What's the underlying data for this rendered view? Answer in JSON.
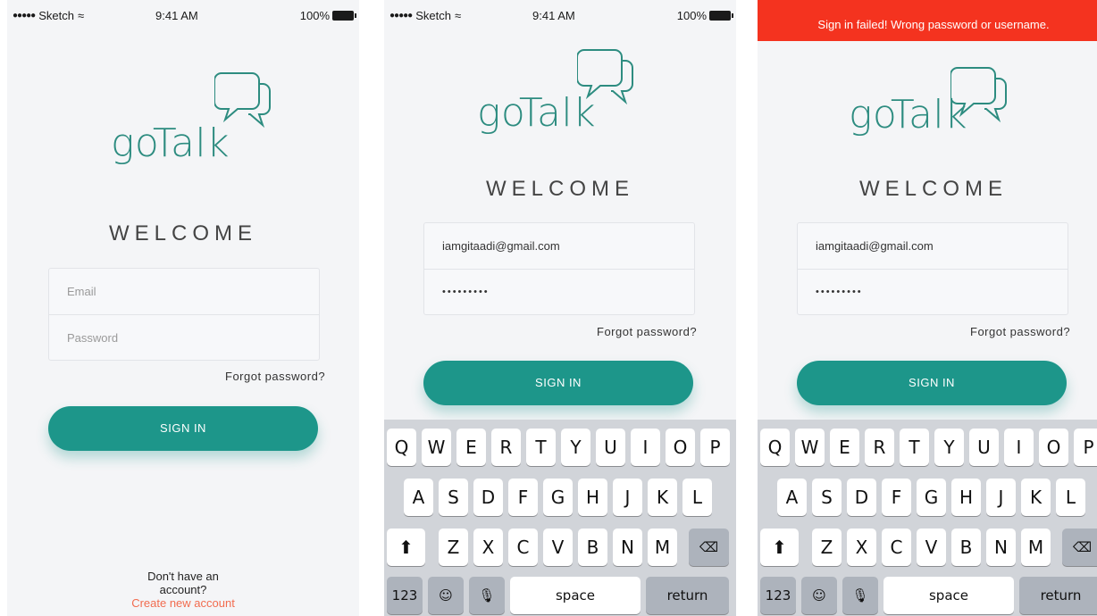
{
  "status_bar": {
    "carrier": "Sketch",
    "time": "9:41 AM",
    "battery": "100%"
  },
  "app": {
    "logo_text": "goTalk",
    "welcome": "WELCOME"
  },
  "form": {
    "email_placeholder": "Email",
    "password_placeholder": "Password",
    "email_value": "iamgitaadi@gmail.com",
    "password_masked": "•••••••••",
    "forgot": "Forgot password?",
    "signin": "SIGN IN"
  },
  "footer": {
    "line1": "Don't have an",
    "line2": "account?",
    "create": "Create new account"
  },
  "error": {
    "message": "Sign in failed! Wrong password or username."
  },
  "keyboard": {
    "row1": [
      "Q",
      "W",
      "E",
      "R",
      "T",
      "Y",
      "U",
      "I",
      "O",
      "P"
    ],
    "row2": [
      "A",
      "S",
      "D",
      "F",
      "G",
      "H",
      "J",
      "K",
      "L"
    ],
    "row3": [
      "Z",
      "X",
      "C",
      "V",
      "B",
      "N",
      "M"
    ],
    "numbers": "123",
    "space": "space",
    "return": "return"
  },
  "icons": {
    "wifi": "wifi-icon",
    "battery": "battery-icon",
    "chat": "chat-bubbles-icon",
    "shift": "shift-icon",
    "backspace": "backspace-icon",
    "emoji": "emoji-icon",
    "mic": "microphone-icon"
  },
  "colors": {
    "brand": "#2d8c80",
    "button": "#1d968a",
    "error": "#f4331f",
    "link": "#f26c4f"
  }
}
